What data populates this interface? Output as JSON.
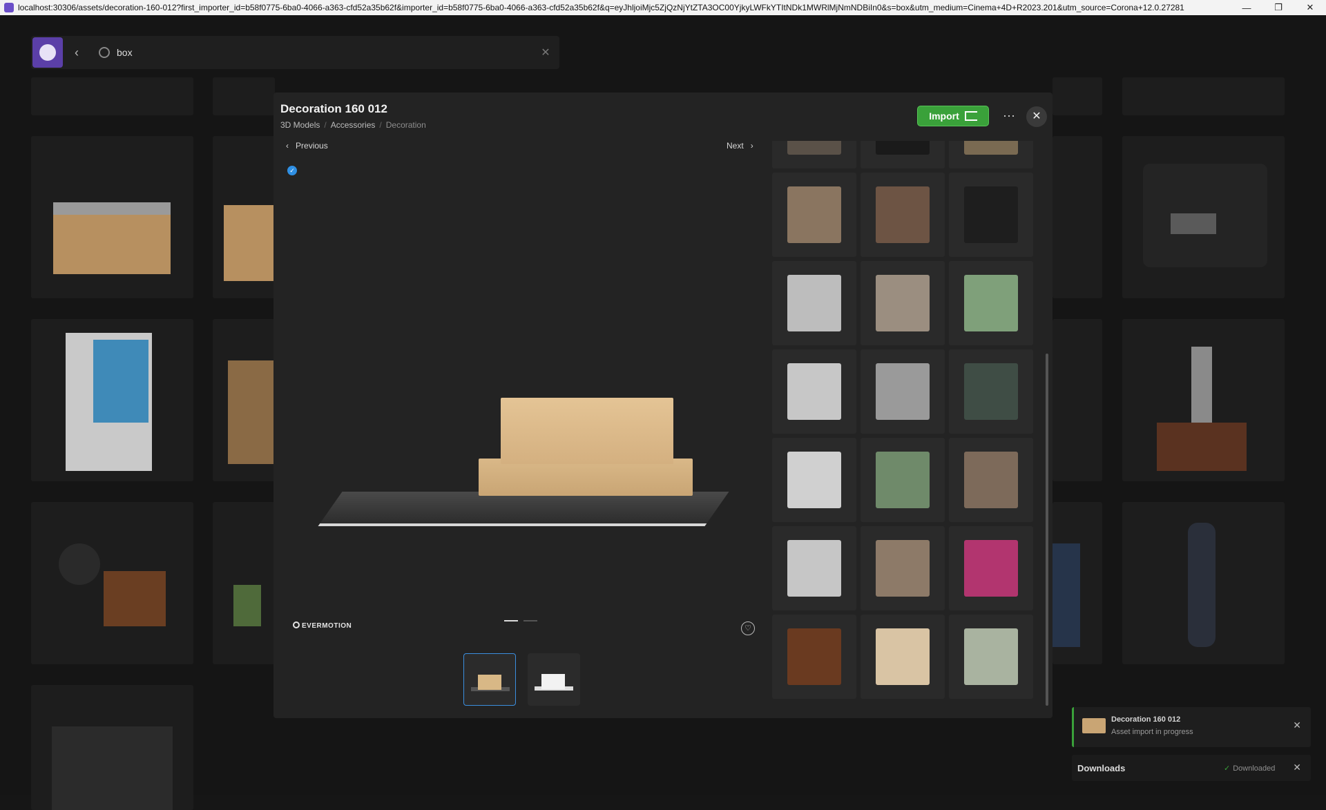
{
  "window": {
    "url": "localhost:30306/assets/decoration-160-012?first_importer_id=b58f0775-6ba0-4066-a363-cfd52a35b62f&importer_id=b58f0775-6ba0-4066-a363-cfd52a35b62f&q=eyJhljoiMjc5ZjQzNjYtZTA3OC00YjkyLWFkYTItNDk1MWRlMjNmNDBiIn0&s=box&utm_medium=Cinema+4D+R2023.201&utm_source=Corona+12.0.27281",
    "minimize": "—",
    "restore": "❐",
    "close": "✕"
  },
  "search": {
    "query": "box",
    "back": "‹",
    "clear": "✕"
  },
  "modal": {
    "title": "Decoration 160 012",
    "breadcrumbs": [
      "3D Models",
      "Accessories",
      "Decoration"
    ],
    "import_label": "Import",
    "more_label": "···",
    "close_label": "✕",
    "previous_label": "Previous",
    "next_label": "Next",
    "prev_arrow": "‹",
    "next_arrow": "›",
    "check": "✓",
    "brand": "EVERMOTION",
    "fav_icon": "♡"
  },
  "gallery": {
    "active_index": 0,
    "thumb_count": 2
  },
  "related_grid": {
    "colors": [
      "#5a5148",
      "#1a1a1a",
      "#7a6a52",
      "#8a7560",
      "#6d5444",
      "#1e1e1e",
      "#bdbdbd",
      "#9b8e80",
      "#7fa07a",
      "#c7c7c7",
      "#9a9a9a",
      "#3f4d45",
      "#d0d0d0",
      "#6f8a6a",
      "#7d6a5a",
      "#c6c6c6",
      "#8d7a68",
      "#b2356f",
      "#6a3a20",
      "#d9c4a4",
      "#a9b3a0"
    ]
  },
  "toast": {
    "title": "Decoration 160 012",
    "subtitle": "Asset import in progress",
    "close": "✕"
  },
  "downloads": {
    "title": "Downloads",
    "status": "Downloaded",
    "check": "✓",
    "close": "✕"
  }
}
